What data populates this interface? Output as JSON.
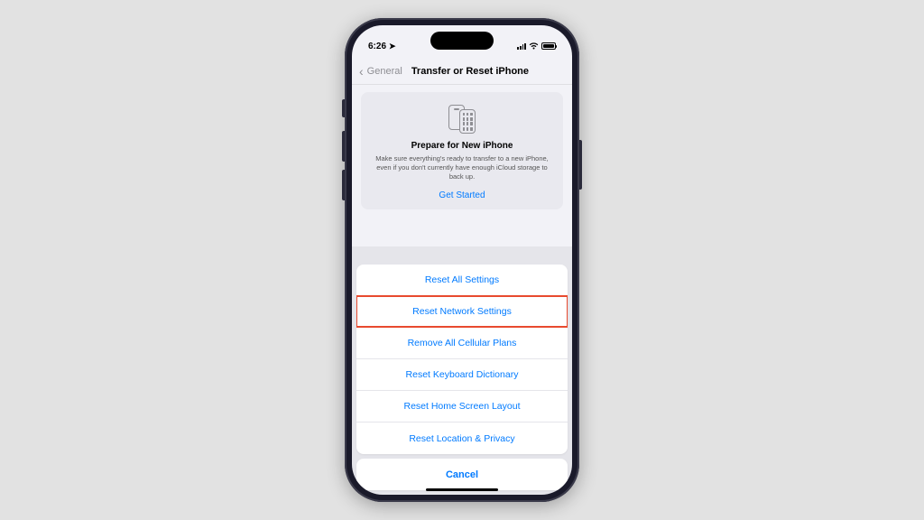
{
  "statusBar": {
    "time": "6:26",
    "locationArrow": "➤"
  },
  "nav": {
    "backLabel": "General",
    "title": "Transfer or Reset iPhone"
  },
  "prepareCard": {
    "title": "Prepare for New iPhone",
    "description": "Make sure everything's ready to transfer to a new iPhone, even if you don't currently have enough iCloud storage to back up.",
    "cta": "Get Started"
  },
  "sheet": {
    "items": [
      "Reset All Settings",
      "Reset Network Settings",
      "Remove All Cellular Plans",
      "Reset Keyboard Dictionary",
      "Reset Home Screen Layout",
      "Reset Location & Privacy"
    ],
    "cancel": "Cancel"
  }
}
